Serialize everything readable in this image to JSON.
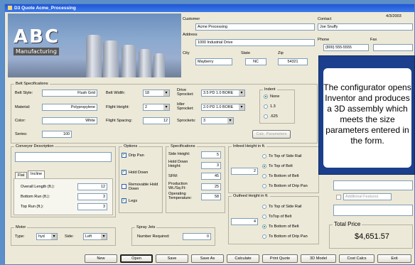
{
  "window": {
    "title": "D3 Quote Acme_Processing"
  },
  "logo": {
    "name": "ABC",
    "subtitle": "Manufacturing"
  },
  "customer": {
    "date": "4/3/2003",
    "customer_label": "Customer",
    "customer_value": "Acme Processing",
    "address_label": "Address",
    "address_value": "1000 Industrial Drive",
    "city_label": "City",
    "city_value": "Mayberry",
    "state_label": "State",
    "state_value": "NC",
    "zip_label": "Zip",
    "zip_value": "54321",
    "contact_label": "Contact",
    "contact_value": "Joe Snuffy",
    "phone_label": "Phone",
    "phone_value": "(800) 555-5555",
    "fax_label": "Fax",
    "fax_value": ""
  },
  "belt": {
    "group": "Belt Specifications",
    "style_label": "Belt Style:",
    "style_value": "Flush Grid",
    "material_label": "Material:",
    "material_value": "Polypropylene",
    "color_label": "Color:",
    "color_value": "White",
    "series_label": "Series:",
    "series_value": "100",
    "width_label": "Belt Width:",
    "width_value": "18",
    "flight_height_label": "Flight Height:",
    "flight_height_value": "2",
    "flight_spacing_label": "Flight Spacing:",
    "flight_spacing_value": "12",
    "drive_label": "Drive Sprocket:",
    "drive_value": "3.5 PD 1.0 BORE",
    "idler_label": "Idler Sprocket:",
    "idler_value": "2.0 PD 1.0 BORE",
    "sprockets_label": "Sprockets:",
    "sprockets_value": "3",
    "indent_group": "Indent",
    "indent_options": [
      "None",
      "1.3",
      ".625"
    ],
    "calc_params": "Calc. Parameters"
  },
  "conveyor": {
    "group": "Conveyor Description",
    "desc_value": "",
    "tabs": [
      "Flat",
      "Incline"
    ],
    "overall_label": "Overall Length (ft.):",
    "overall_value": "12",
    "bottom_label": "Bottom Run (ft.):",
    "bottom_value": "3",
    "top_label": "Top Run (ft.):",
    "top_value": "3"
  },
  "options": {
    "group": "Options",
    "drip_pan": "Drip Pan",
    "hold_down": "Hold Down",
    "removable": "Removable Hold Down",
    "legs": "Legs"
  },
  "specs": {
    "group": "Specifications",
    "side_label": "Side Height:",
    "side_value": "5",
    "hold_label": "Hold Down Height:",
    "hold_value": "3",
    "sfm_label": "SFM:",
    "sfm_value": "45",
    "production_label": "Production Wt./Sq.Ft:",
    "production_value": "25",
    "temp_label": "Operating Temperature:",
    "temp_value": "58"
  },
  "infeed": {
    "group": "Infeed Height in ft.",
    "value": "2",
    "options": [
      "To Top of Side Rail",
      "To Top of Belt",
      "To Bottom of Belt",
      "To Bottom of Drip Pan"
    ]
  },
  "outfeed": {
    "group": "Outfeed Height in ft.",
    "value": "4",
    "options": [
      "To Top of Side Rail",
      "ToTop of Belt",
      "To Bottom of Belt",
      "To Bottom of Drip Pan"
    ]
  },
  "motor": {
    "group": "Motor",
    "type_label": "Type:",
    "type_value": "hyd",
    "side_label": "Side:",
    "side_value": "Left"
  },
  "spray": {
    "group": "Spray Jets",
    "number_label": "Number Required:",
    "number_value": "0"
  },
  "additional": {
    "label": "Additional Features"
  },
  "total": {
    "group": "Total Price",
    "value": "$4,651.57"
  },
  "callout": {
    "text": "The configurator opens Inventor and produces a 3D assembly which meets the size parameters entered in the form."
  },
  "buttons": [
    "New",
    "Open",
    "Save",
    "Save As",
    "Calculate",
    "Print Quote",
    "3D Model",
    "Cost Calcs",
    "Exit"
  ]
}
